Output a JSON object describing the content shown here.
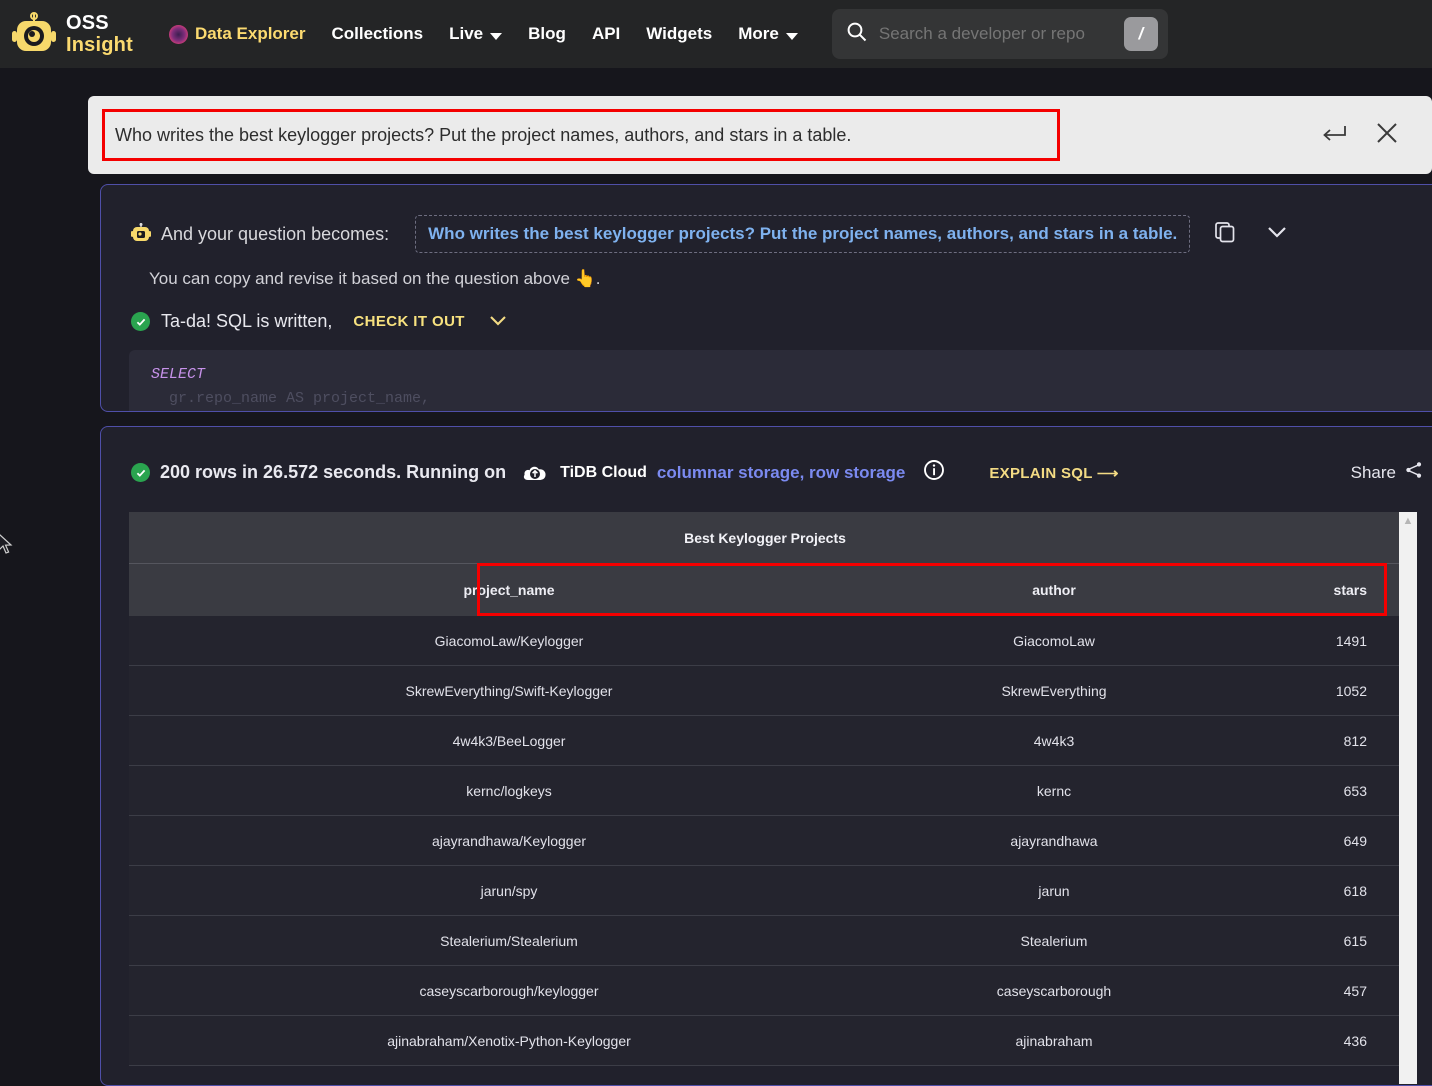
{
  "nav": {
    "brand_line1": "OSS",
    "brand_line2": "Insight",
    "items": [
      {
        "label": "Data Explorer",
        "icon": "purple-orb-icon",
        "active": true,
        "caret": false
      },
      {
        "label": "Collections",
        "active": false,
        "caret": false
      },
      {
        "label": "Live",
        "active": false,
        "caret": true
      },
      {
        "label": "Blog",
        "active": false,
        "caret": false
      },
      {
        "label": "API",
        "active": false,
        "caret": false
      },
      {
        "label": "Widgets",
        "active": false,
        "caret": false
      },
      {
        "label": "More",
        "active": false,
        "caret": true
      }
    ],
    "search": {
      "placeholder": "Search a developer or repo",
      "shortcut_key": "/",
      "icon": "search-icon"
    }
  },
  "question_bar": {
    "value": "Who writes the best keylogger projects? Put the project names, authors, and stars in a table.",
    "enter_icon": "enter-return-icon",
    "close_icon": "close-icon"
  },
  "sql_panel": {
    "robot_icon": "robot-icon",
    "becomes_label": "And your question becomes:",
    "question_echo": "Who writes the best keylogger projects? Put the project names, authors, and stars in a table.",
    "copy_icon": "copy-icon",
    "expand_icon": "chevron-down-icon",
    "hint": "You can copy and revise it based on the question above 👆.",
    "status_icon": "check-circle-icon",
    "status_text": "Ta-da! SQL is written,",
    "check_it_out": "CHECK IT OUT",
    "check_caret": "chevron-down-icon",
    "code_line1": "SELECT",
    "code_line2": "gr.repo_name AS project_name,"
  },
  "result_panel": {
    "status_icon": "check-circle-icon",
    "status_text": "200 rows in 26.572 seconds. Running on",
    "tidb_logo": "tidb-cloud-icon",
    "tidb_label": "TiDB Cloud",
    "storage_links": "columnar storage, row storage",
    "info_icon": "info-icon",
    "explain_sql": "EXPLAIN SQL ⟶",
    "share_label": "Share",
    "share_icon": "share-icon",
    "scrollbar_up_icon": "chevron-up-icon"
  },
  "table": {
    "title": "Best Keylogger Projects",
    "columns": [
      "project_name",
      "author",
      "stars"
    ],
    "rows": [
      {
        "project_name": "GiacomoLaw/Keylogger",
        "author": "GiacomoLaw",
        "stars": "1491"
      },
      {
        "project_name": "SkrewEverything/Swift-Keylogger",
        "author": "SkrewEverything",
        "stars": "1052"
      },
      {
        "project_name": "4w4k3/BeeLogger",
        "author": "4w4k3",
        "stars": "812"
      },
      {
        "project_name": "kernc/logkeys",
        "author": "kernc",
        "stars": "653"
      },
      {
        "project_name": "ajayrandhawa/Keylogger",
        "author": "ajayrandhawa",
        "stars": "649"
      },
      {
        "project_name": "jarun/spy",
        "author": "jarun",
        "stars": "618"
      },
      {
        "project_name": "Stealerium/Stealerium",
        "author": "Stealerium",
        "stars": "615"
      },
      {
        "project_name": "caseyscarborough/keylogger",
        "author": "caseyscarborough",
        "stars": "457"
      },
      {
        "project_name": "ajinabraham/Xenotix-Python-Keylogger",
        "author": "ajinabraham",
        "stars": "436"
      }
    ]
  },
  "colors": {
    "page_bg": "#16161c",
    "nav_bg": "#242526",
    "panel_bg": "#21212c",
    "panel_border": "#4f4fa8",
    "accent_yellow": "#fbda70",
    "link_blue": "#7b8af0",
    "highlight_red": "#f40000",
    "success_green": "#2aa44f"
  }
}
